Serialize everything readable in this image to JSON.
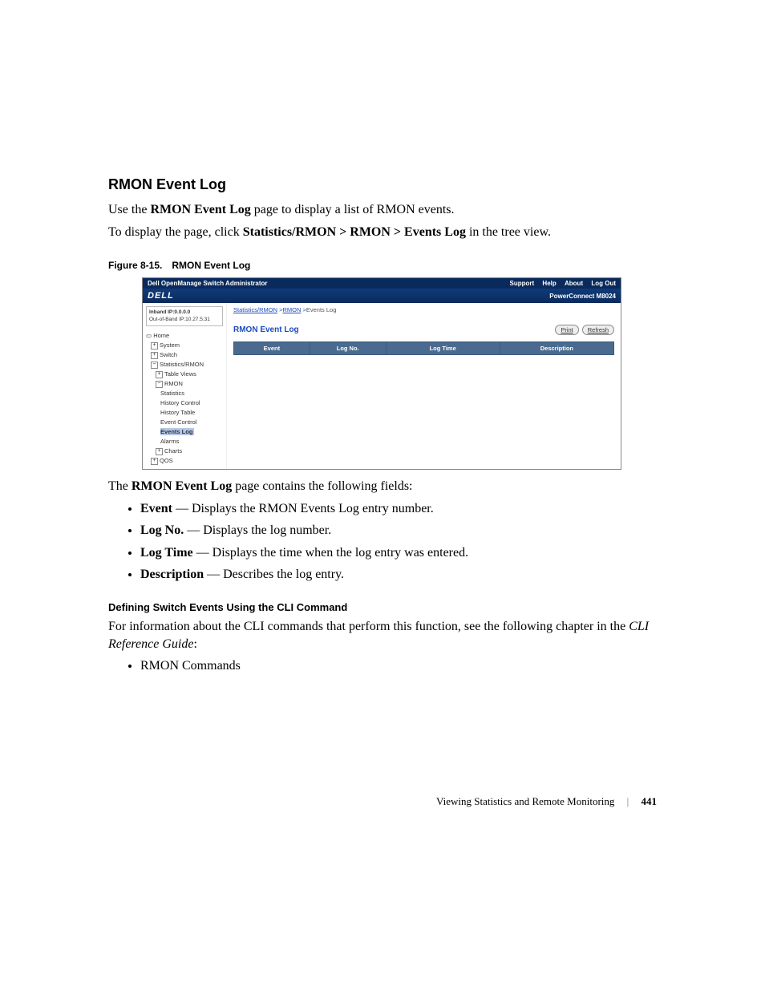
{
  "section": {
    "title": "RMON Event Log",
    "intro_line_1_pre": "Use the ",
    "intro_line_1_bold": "RMON Event Log",
    "intro_line_1_post": " page to display a list of RMON events.",
    "intro_line_2_pre": "To display the page, click ",
    "intro_line_2_bold": "Statistics/RMON > RMON > Events Log",
    "intro_line_2_post": " in the tree view."
  },
  "figure": {
    "label": "Figure 8-15.",
    "caption": "RMON Event Log"
  },
  "screenshot": {
    "titlebar": {
      "left": "Dell OpenManage Switch Administrator",
      "links": [
        "Support",
        "Help",
        "About",
        "Log Out"
      ]
    },
    "banner": {
      "logo": "DELL",
      "model": "PowerConnect M8024"
    },
    "ip_box": {
      "line1": "Inband IP:0.0.0.0",
      "line2": "Out-of-Band IP:10.27.5.31"
    },
    "tree": {
      "home": "Home",
      "system": "System",
      "switch": "Switch",
      "stats_rmon": "Statistics/RMON",
      "table_views": "Table Views",
      "rmon": "RMON",
      "statistics": "Statistics",
      "history_control": "History Control",
      "history_table": "History Table",
      "event_control": "Event Control",
      "events_log": "Events Log",
      "alarms": "Alarms",
      "charts": "Charts",
      "qos": "QOS"
    },
    "breadcrumb": {
      "c1": "Statistics/RMON",
      "c2": "RMON",
      "c3": "Events Log"
    },
    "content_title": "RMON Event Log",
    "buttons": {
      "print": "Print",
      "refresh": "Refresh"
    },
    "table_headers": {
      "event": "Event",
      "log_no": "Log No.",
      "log_time": "Log Time",
      "description": "Description"
    }
  },
  "fields_intro_pre": "The ",
  "fields_intro_bold": "RMON Event Log",
  "fields_intro_post": " page contains the following fields:",
  "fields": {
    "event": {
      "name": "Event",
      "desc": " — Displays the RMON Events Log entry number."
    },
    "logno": {
      "name": "Log No.",
      "desc": " — Displays the log number."
    },
    "logtime": {
      "name": "Log Time",
      "desc": " — Displays the time when the log entry was entered."
    },
    "description": {
      "name": "Description",
      "desc": " — Describes the log entry."
    }
  },
  "subheading": "Defining Switch Events Using the CLI Command",
  "cli_intro_pre": "For information about the CLI commands that perform this function, see the following chapter in the ",
  "cli_intro_italic": "CLI Reference Guide",
  "cli_intro_post": ":",
  "cli_list": {
    "item1": "RMON Commands"
  },
  "footer": {
    "chapter": "Viewing Statistics and Remote Monitoring",
    "page": "441"
  }
}
